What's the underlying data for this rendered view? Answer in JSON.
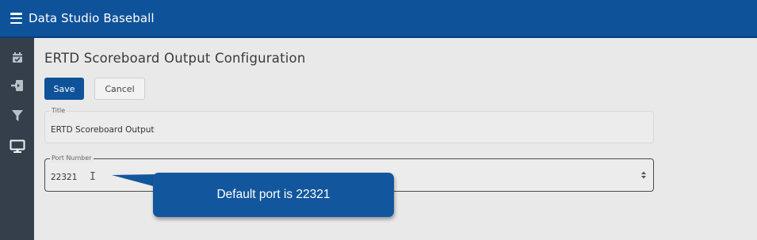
{
  "header": {
    "app_title": "Data Studio Baseball",
    "menu_icon": "hamburger-menu-icon"
  },
  "sidebar": {
    "items": [
      {
        "icon": "calendar-check-icon"
      },
      {
        "icon": "import-icon"
      },
      {
        "icon": "filter-icon"
      },
      {
        "icon": "monitor-icon"
      }
    ]
  },
  "main": {
    "page_title": "ERTD Scoreboard Output Configuration",
    "save_label": "Save",
    "cancel_label": "Cancel",
    "title_field": {
      "label": "Title",
      "value": "ERTD Scoreboard Output"
    },
    "port_field": {
      "label": "Port Number",
      "value": "22321"
    }
  },
  "callout": {
    "text": "Default port is 22321"
  },
  "colors": {
    "header_bg": "#0e5299",
    "sidebar_bg": "#353f4b",
    "save_bg": "#0e5299",
    "callout_bg": "#12579d"
  }
}
